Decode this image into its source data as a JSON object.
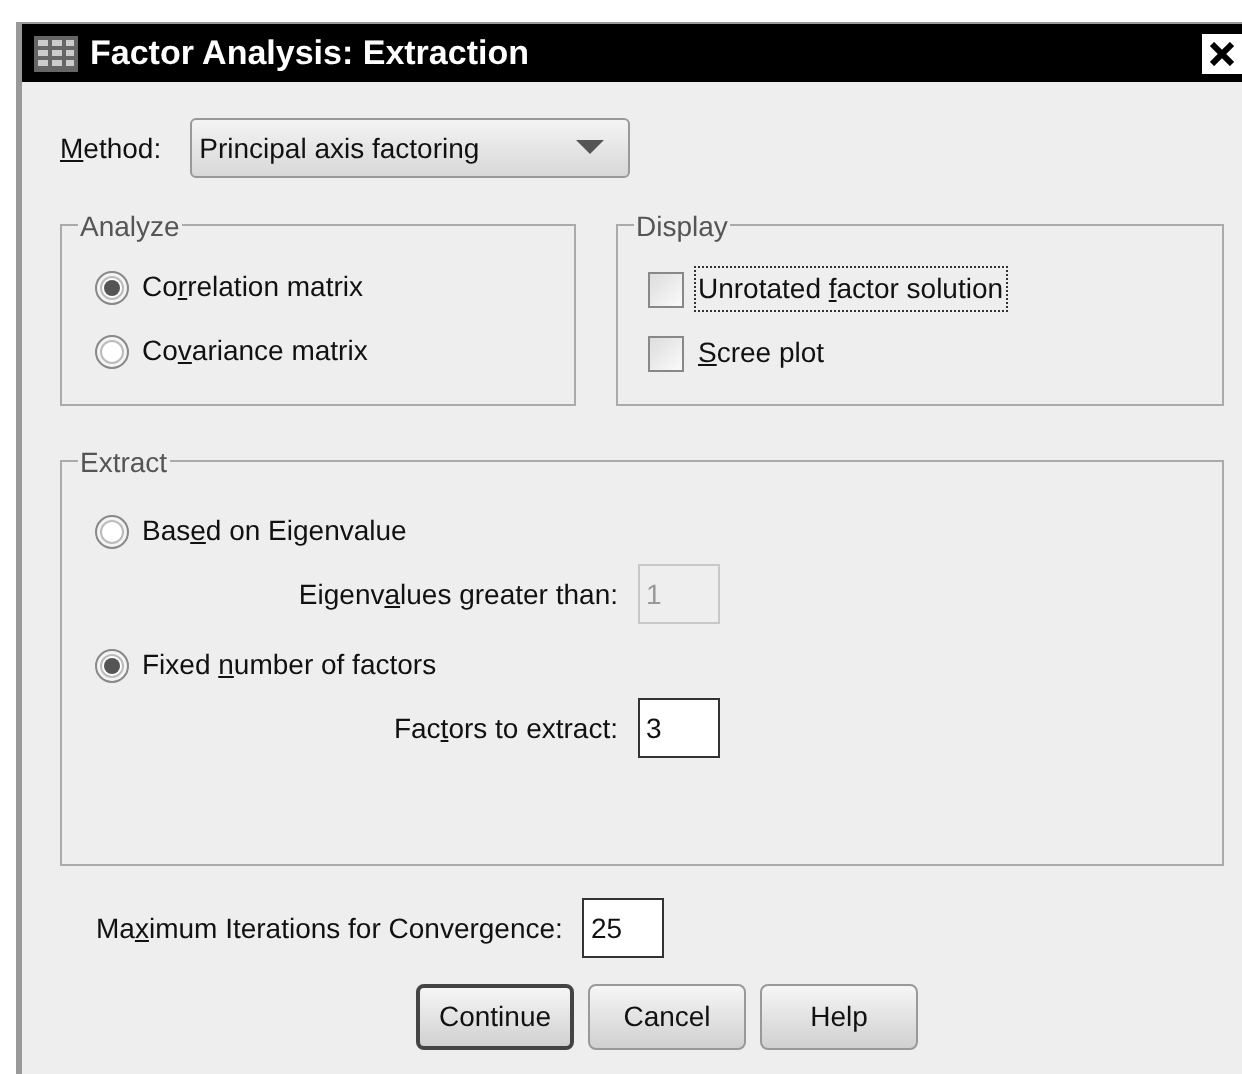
{
  "window": {
    "title": "Factor Analysis: Extraction"
  },
  "method": {
    "label": {
      "key": "M",
      "post": "ethod:"
    },
    "value": "Principal axis factoring"
  },
  "analyze": {
    "title": "Analyze",
    "options": [
      {
        "label": {
          "pre": "Co",
          "key": "r",
          "post": "relation matrix"
        },
        "selected": true
      },
      {
        "label": {
          "pre": "Co",
          "key": "v",
          "post": "ariance matrix"
        },
        "selected": false
      }
    ]
  },
  "display": {
    "title": "Display",
    "options": [
      {
        "label": {
          "pre": "Unrotated ",
          "key": "f",
          "post": "actor solution"
        },
        "checked": false,
        "focused": true
      },
      {
        "label": {
          "key": "S",
          "post": "cree plot"
        },
        "checked": false,
        "focused": false
      }
    ]
  },
  "extract": {
    "title": "Extract",
    "options": [
      {
        "label": {
          "pre": "Bas",
          "key": "e",
          "post": "d on Eigenvalue"
        },
        "selected": false,
        "field": {
          "label": {
            "pre": "Eigenv",
            "key": "a",
            "post": "lues greater than:"
          },
          "value": "1",
          "disabled": true
        }
      },
      {
        "label": {
          "pre": "Fixed ",
          "key": "n",
          "post": "umber of factors"
        },
        "selected": true,
        "field": {
          "label": {
            "pre": "Fac",
            "key": "t",
            "post": "ors to extract:"
          },
          "value": "3",
          "disabled": false
        }
      }
    ]
  },
  "max_iterations": {
    "label": {
      "pre": "Ma",
      "key": "x",
      "post": "imum Iterations for Convergence:"
    },
    "value": "25"
  },
  "buttons": [
    {
      "label": "Continue",
      "default": true
    },
    {
      "label": "Cancel",
      "default": false
    },
    {
      "label": "Help",
      "default": false
    }
  ]
}
